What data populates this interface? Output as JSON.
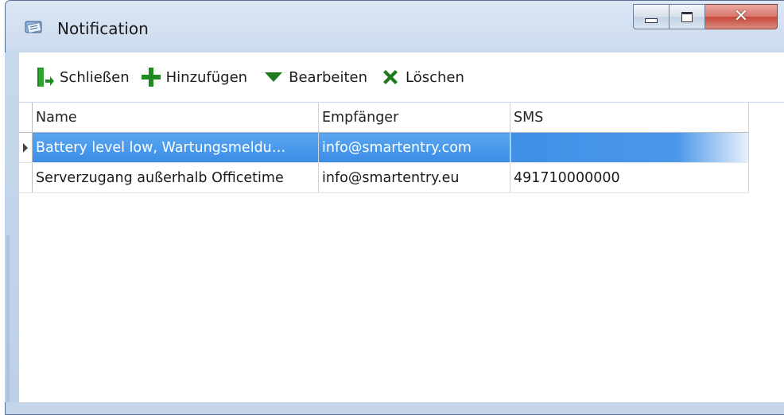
{
  "window": {
    "title": "Notification",
    "close_glyph": "✕"
  },
  "toolbar": {
    "close": {
      "label": "Schließen",
      "icon": "exit-icon"
    },
    "add": {
      "label": "Hinzufügen",
      "icon": "plus-icon"
    },
    "edit": {
      "label": "Bearbeiten",
      "icon": "triangle-down-icon"
    },
    "delete": {
      "label": "Löschen",
      "icon": "x-icon"
    }
  },
  "grid": {
    "columns": [
      "Name",
      "Empfänger",
      "SMS"
    ],
    "rows": [
      {
        "name": "Battery level low, Wartungsmeldu…",
        "recipient": "info@smartentry.com",
        "sms": "",
        "selected": true
      },
      {
        "name": "Serverzugang außerhalb Officetime",
        "recipient": "info@smartentry.eu",
        "sms": "491710000000",
        "selected": false
      }
    ]
  },
  "colors": {
    "selection": "#3a8de6",
    "icon_green": "#1f8a1f"
  }
}
